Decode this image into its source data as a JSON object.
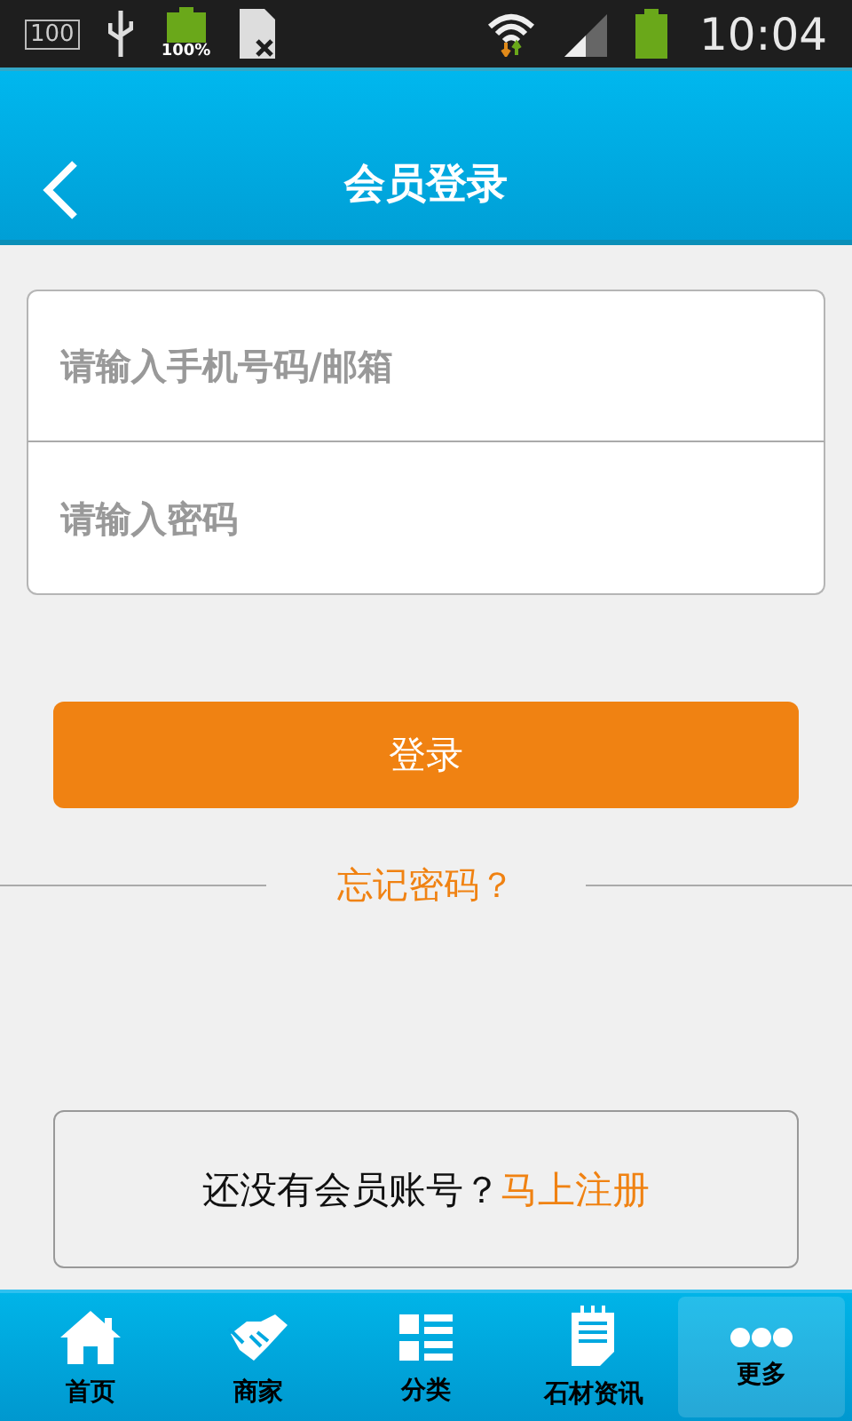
{
  "status_bar": {
    "storage": "100",
    "battery_percent": "100%",
    "time": "10:04"
  },
  "header": {
    "title": "会员登录"
  },
  "form": {
    "fields": [
      {
        "placeholder": "请输入手机号码/邮箱"
      },
      {
        "placeholder": "请输入密码"
      }
    ],
    "submit": "登录",
    "forgot": "忘记密码？"
  },
  "register": {
    "text": "还没有会员账号？",
    "link": "马上注册"
  },
  "tab_bar": [
    {
      "label": "首页",
      "kind": "home",
      "selected": false
    },
    {
      "label": "商家",
      "kind": "handshake",
      "selected": false
    },
    {
      "label": "分类",
      "kind": "grid",
      "selected": false
    },
    {
      "label": "石材资讯",
      "kind": "notepad",
      "selected": false
    },
    {
      "label": "更多",
      "kind": "more",
      "selected": true
    }
  ]
}
